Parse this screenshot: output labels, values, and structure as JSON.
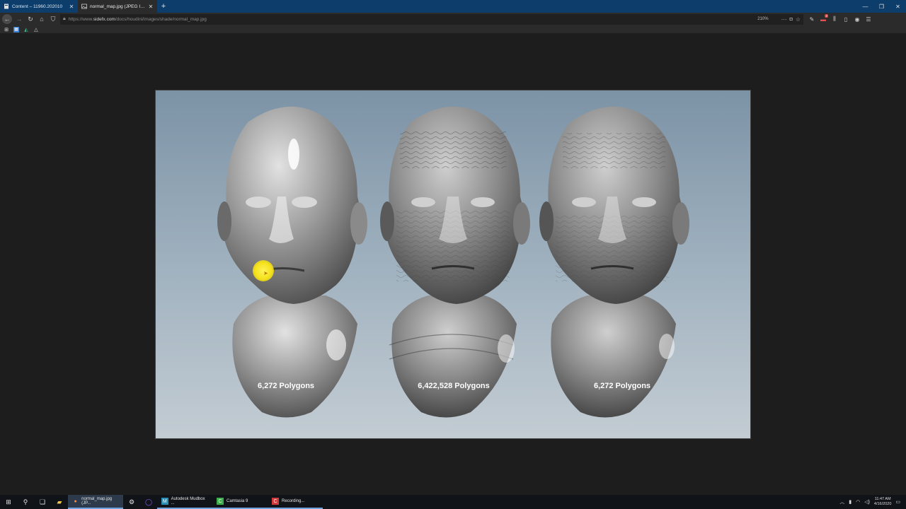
{
  "browser": {
    "tabs": [
      {
        "title": "Content – 11960.202010",
        "active": false,
        "icon": "page-icon"
      },
      {
        "title": "normal_map.jpg (JPEG Image, 800",
        "active": true,
        "icon": "image-icon"
      }
    ],
    "url": {
      "prefix": "https://www.",
      "domain": "sidefx.com",
      "path": "/docs/houdini/images/shade/normal_map.jpg"
    },
    "zoom": "210%"
  },
  "image": {
    "labels": [
      "6,272 Polygons",
      "6,422,528 Polygons",
      "6,272 Polygons"
    ]
  },
  "taskbar": {
    "apps": [
      {
        "label": "normal_map.jpg (JP...",
        "icon": "firefox-icon",
        "state": "active"
      },
      {
        "label": "Autodesk Mudbox ...",
        "icon": "mudbox-icon",
        "state": "running"
      },
      {
        "label": "Camtasia 9",
        "icon": "camtasia-icon",
        "state": "running"
      },
      {
        "label": "Recording...",
        "icon": "recording-icon",
        "state": "running"
      }
    ],
    "time": "11:47 AM",
    "date": "4/16/2020"
  },
  "colors": {
    "tabstrip": "#0c3d6b",
    "toolbar": "#2b2b2b",
    "viewer": "#1d1d1d",
    "cursor_highlight": "#f4e11b"
  }
}
